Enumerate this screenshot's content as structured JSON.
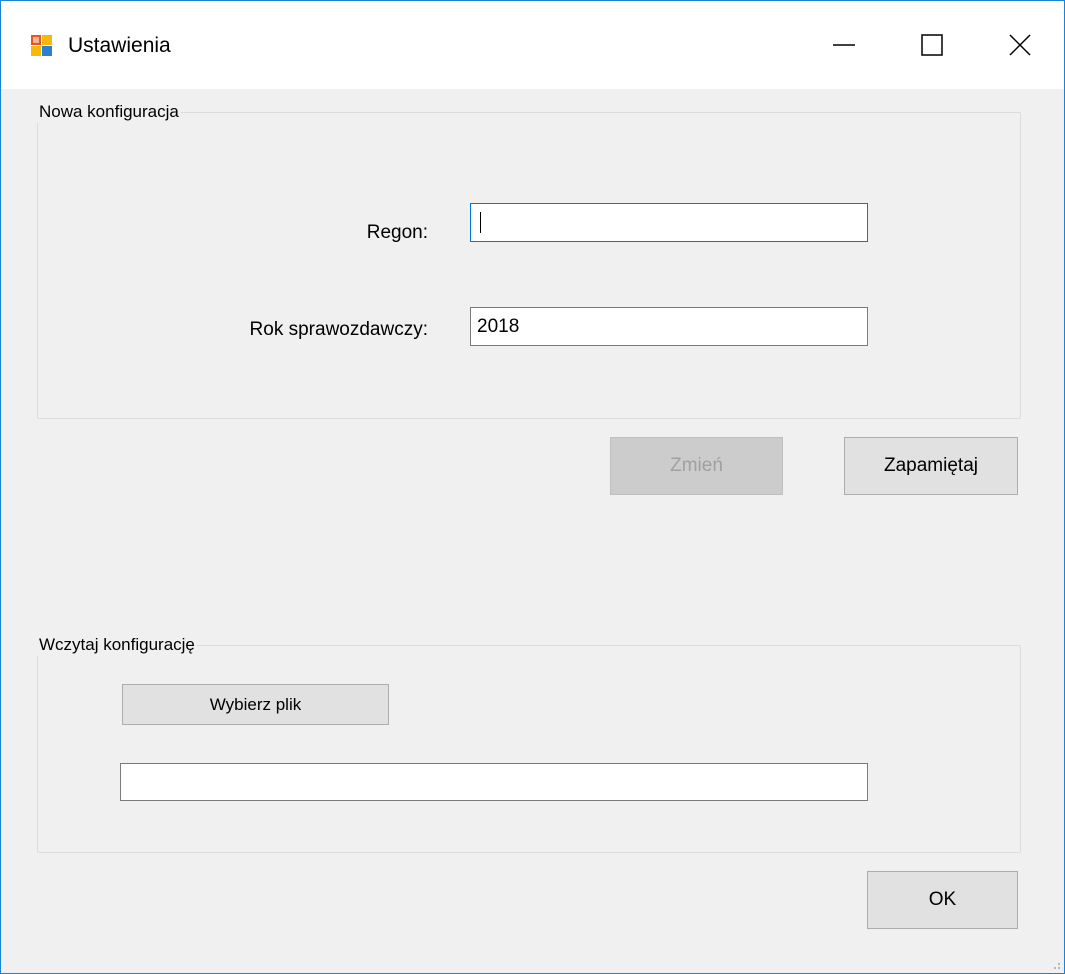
{
  "window": {
    "title": "Ustawienia",
    "icons": {
      "app": "app-window-icon",
      "minimize": "minimize-icon",
      "maximize": "maximize-icon",
      "close": "close-icon"
    }
  },
  "new_config": {
    "group_label": "Nowa konfiguracja",
    "regon": {
      "label": "Regon:",
      "value": ""
    },
    "year": {
      "label": "Rok sprawozdawczy:",
      "value": "2018"
    },
    "change_button": "Zmień",
    "save_button": "Zapamiętaj"
  },
  "load_config": {
    "group_label": "Wczytaj konfigurację",
    "choose_button": "Wybierz plik",
    "file_path": ""
  },
  "ok_button": "OK",
  "colors": {
    "window_border": "#1883d7",
    "client_background": "#f0f0f0",
    "focus_border": "#0078d7",
    "button_background": "#e1e1e1",
    "disabled_button_background": "#cccccc",
    "disabled_text": "#a0a0a0"
  }
}
